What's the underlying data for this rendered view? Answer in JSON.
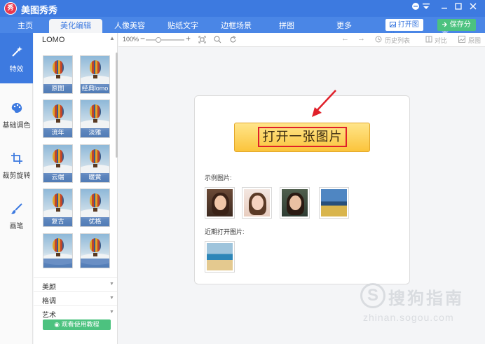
{
  "window": {
    "title": "美图秀秀",
    "controls": [
      "chat-icon",
      "menu-icon",
      "minimize-icon",
      "maximize-icon",
      "close-icon"
    ]
  },
  "nav": {
    "tabs": [
      {
        "label": "主页",
        "active": false
      },
      {
        "label": "美化编辑",
        "active": true
      },
      {
        "label": "人像美容",
        "active": false
      },
      {
        "label": "贴纸文字",
        "active": false
      },
      {
        "label": "边框场景",
        "active": false
      },
      {
        "label": "拼图",
        "active": false
      },
      {
        "label": "更多",
        "active": false
      }
    ],
    "open_label": "打开图片",
    "save_label": "保存分享"
  },
  "sidebar": {
    "items": [
      {
        "label": "特效",
        "icon": "magic-wand-icon",
        "active": true
      },
      {
        "label": "基础调色",
        "icon": "palette-icon",
        "active": false
      },
      {
        "label": "裁剪旋转",
        "icon": "crop-icon",
        "active": false
      },
      {
        "label": "画笔",
        "icon": "brush-icon",
        "active": false
      }
    ]
  },
  "effects_panel": {
    "header": "LOMO",
    "thumbnails": [
      "原图",
      "经典lomo",
      "流年",
      "淡雅",
      "云端",
      "暖黄",
      "复古",
      "优格",
      "",
      ""
    ],
    "categories": [
      "美颜",
      "格调",
      "艺术"
    ],
    "tutorial_label": "观看使用教程"
  },
  "toolbar": {
    "zoom": "100%",
    "history_label": "历史列表",
    "compare_label": "对比",
    "original_label": "原图"
  },
  "canvas": {
    "open_button_label": "打开一张图片",
    "sample_label": "示例图片:",
    "recent_label": "近期打开图片:",
    "sample_count": 4,
    "recent_count": 1
  },
  "watermark": {
    "brand": "搜狗指南",
    "site": "zhinan.sogou.com"
  },
  "colors": {
    "primary": "#3d7ae0",
    "save_green": "#4cc27f",
    "open_yellow": "#fbc43b",
    "highlight_red": "#e0202a"
  }
}
